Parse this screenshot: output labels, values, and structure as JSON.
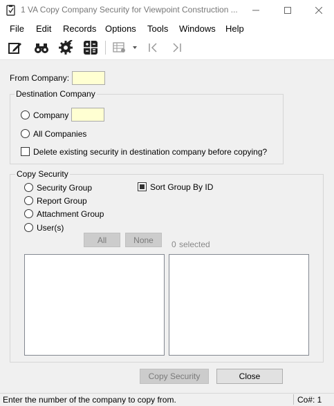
{
  "window": {
    "title": "1 VA Copy Company Security for Viewpoint Construction ..."
  },
  "menu": {
    "items": [
      "File",
      "Edit",
      "Records",
      "Options",
      "Tools",
      "Windows",
      "Help"
    ]
  },
  "toolbar": {
    "icons": [
      "edit-form-icon",
      "binoculars-icon",
      "gear-check-icon",
      "calculator-icon",
      "grid-settings-icon",
      "dropdown-arrow-icon",
      "first-record-icon",
      "last-record-icon"
    ]
  },
  "form": {
    "from_company_label": "From Company:",
    "from_company_value": "",
    "destination": {
      "title": "Destination Company",
      "company_label": "Company",
      "company_value": "",
      "all_companies_label": "All Companies",
      "delete_label": "Delete existing security in destination company before copying?"
    },
    "copy_security": {
      "title": "Copy Security",
      "options": [
        "Security Group",
        "Report Group",
        "Attachment Group",
        "User(s)"
      ],
      "sort_label": "Sort Group By ID",
      "sort_checked": true,
      "all_button": "All",
      "none_button": "None",
      "selected_count": "0",
      "selected_label": "selected"
    },
    "copy_button": "Copy Security",
    "close_button": "Close"
  },
  "status": {
    "message": "Enter the number of the company to copy from.",
    "company": "Co#: 1"
  }
}
